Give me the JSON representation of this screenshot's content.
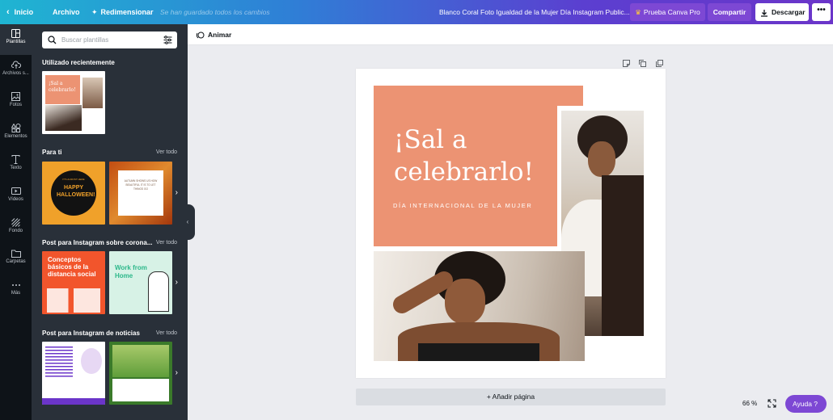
{
  "topbar": {
    "home_label": "Inicio",
    "file_label": "Archivo",
    "resize_label": "Redimensionar",
    "status_text": "Se han guardado todos los cambios",
    "document_title": "Blanco Coral Foto Igualdad de la Mujer Día Instagram Public...",
    "pro_label": "Prueba Canva Pro",
    "share_label": "Compartir",
    "download_label": "Descargar",
    "more_label": "•••"
  },
  "rail": {
    "items": [
      {
        "label": "Plantillas",
        "icon": "templates-icon"
      },
      {
        "label": "Archivos s...",
        "icon": "upload-icon"
      },
      {
        "label": "Fotos",
        "icon": "photos-icon"
      },
      {
        "label": "Elementos",
        "icon": "elements-icon"
      },
      {
        "label": "Texto",
        "icon": "text-icon"
      },
      {
        "label": "Vídeos",
        "icon": "videos-icon"
      },
      {
        "label": "Fondo",
        "icon": "background-icon"
      },
      {
        "label": "Carpetas",
        "icon": "folder-icon"
      },
      {
        "label": "Más",
        "icon": "more-icon"
      }
    ]
  },
  "panel": {
    "search_placeholder": "Buscar plantillas",
    "recent_title": "Utilizado recientemente",
    "recent_thumb_text": "¡Sal a celebrarlo!",
    "sections": [
      {
        "title": "Para ti",
        "see_all": "Ver todo"
      },
      {
        "title": "Post para Instagram sobre corona...",
        "see_all": "Ver todo"
      },
      {
        "title": "Post para Instagram de noticias",
        "see_all": "Ver todo"
      }
    ],
    "thumb_halloween_small": "IT'S ALMOST HERE",
    "thumb_halloween": "HAPPY HALLOWEEN!",
    "thumb_quote": "AUTUMN SHOWS US HOW BEAUTIFUL IT IS TO LET THINGS GO",
    "thumb_concepts": "Conceptos básicos de la distancia social",
    "thumb_work": "Work from Home"
  },
  "toolbar": {
    "animate_label": "Animar"
  },
  "design": {
    "headline_line1": "¡Sal a",
    "headline_line2": "celebrarlo!",
    "subline": "DÍA INTERNACIONAL DE LA MUJER",
    "colors": {
      "salmon": "#ec9373",
      "purple": "#7d48d4"
    }
  },
  "canvas": {
    "add_page_label": "+ Añadir página",
    "zoom_level": "66 %",
    "help_label": "Ayuda ?"
  }
}
